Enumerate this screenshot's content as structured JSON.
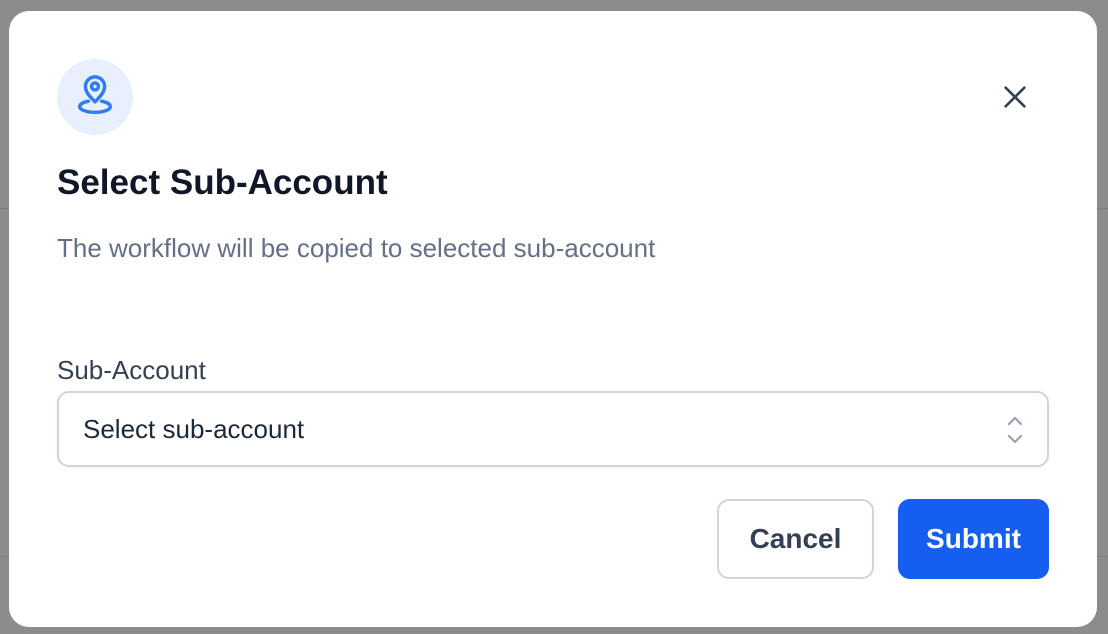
{
  "modal": {
    "title": "Select Sub-Account",
    "subtitle": "The workflow will be copied to selected sub-account",
    "icon": "map-pin-icon",
    "close_icon": "close-icon"
  },
  "form": {
    "field_label": "Sub-Account",
    "select": {
      "selected_value": "Select sub-account",
      "chevron_icon": "chevron-up-down-icon"
    }
  },
  "actions": {
    "cancel_label": "Cancel",
    "submit_label": "Submit"
  },
  "colors": {
    "primary": "#155eef",
    "icon_bg": "#e8f0fd",
    "icon_color": "#2e7cf6",
    "title": "#101828",
    "subtitle": "#667085",
    "border": "#d0d5dd",
    "overlay": "#8c8c8c"
  }
}
